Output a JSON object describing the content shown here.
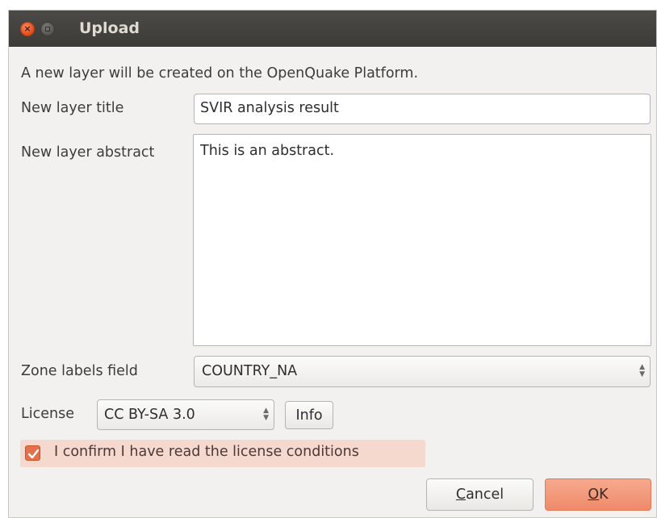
{
  "window": {
    "title": "Upload"
  },
  "titlebar": {
    "close_glyph": "×",
    "close_icon": "close-icon",
    "maximize_icon": "maximize-icon"
  },
  "dialog": {
    "info_text": "A new layer will be created on the OpenQuake Platform.",
    "title_label": "New layer title",
    "title_value": "SVIR analysis result",
    "abstract_label": "New layer abstract",
    "abstract_value": "This is an abstract.",
    "zone_label": "Zone labels field",
    "zone_value": "COUNTRY_NA",
    "license_label": "License",
    "license_value": "CC BY-SA 3.0",
    "info_button": "Info",
    "confirm_label": "I confirm I have read the license conditions",
    "confirm_checked": true,
    "cancel_button": "Cancel",
    "ok_button": "OK"
  },
  "colors": {
    "titlebar": "#3c3b37",
    "accent": "#e4704c",
    "ok_button": "#f29a7c",
    "confirm_highlight": "#f5d9cf"
  }
}
